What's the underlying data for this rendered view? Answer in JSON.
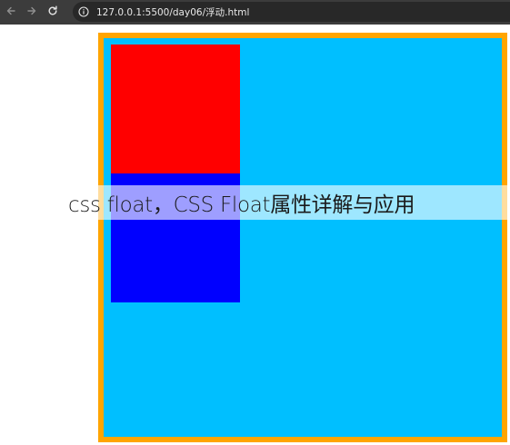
{
  "browser": {
    "back_icon": "arrow-left-icon",
    "forward_icon": "arrow-right-icon",
    "reload_icon": "reload-icon",
    "info_icon": "info-icon",
    "url": "127.0.0.1:5500/day06/浮动.html"
  },
  "page": {
    "overlay_title": "css float，CSS Float属性详解与应用"
  },
  "colors": {
    "container_background": "#00bfff",
    "container_border": "#ffa500",
    "box_red": "#ff0000",
    "box_blue": "#0000ff"
  }
}
